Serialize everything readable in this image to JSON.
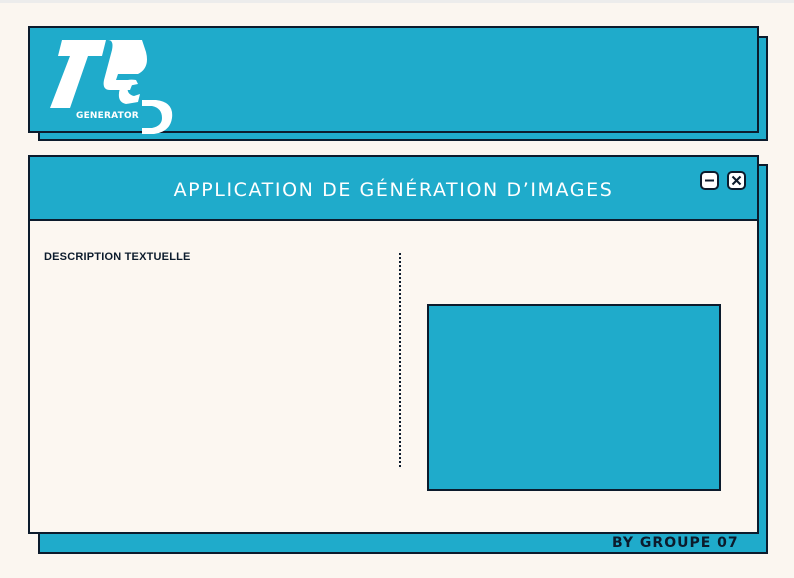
{
  "logo": {
    "wordmark": "GENERATOR"
  },
  "window": {
    "title": "APPLICATION DE GÉNÉRATION D’IMAGES",
    "minimize_icon": "minus-icon",
    "close_icon": "x-icon"
  },
  "description": {
    "label": "DESCRIPTION TEXTUELLE",
    "value": ""
  },
  "output": {
    "image": ""
  },
  "footer": {
    "credit": "BY GROUPE 07"
  },
  "colors": {
    "accent": "#1fabcb",
    "border": "#0c1b2c",
    "background": "#fbf6f0",
    "text_light": "#ffffff"
  }
}
